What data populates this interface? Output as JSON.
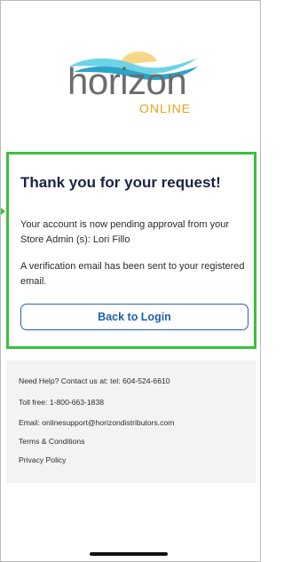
{
  "logo": {
    "wordmark": "horizon",
    "subtitle": "ONLINE",
    "colors": {
      "wave_light": "#6fd3e6",
      "wave_dark": "#2aa4c9",
      "sun": "#f4c24a",
      "wordmark": "#6c6c6c",
      "subtitle": "#e8a317"
    }
  },
  "confirmation": {
    "title": "Thank you for your request!",
    "pending_message": "Your account is now pending approval from your Store Admin (s): Lori Fillo",
    "verification_message": "A verification email has been sent to your registered email.",
    "back_button_label": "Back to Login",
    "highlight_color": "#3ac13a",
    "accent_color": "#1f5fa8"
  },
  "footer": {
    "help_line": "Need Help? Contact us at: tel: 604-524-6610",
    "toll_free": "Toll free: 1-800-663-1838",
    "email": "Email: onlinesupport@horizondistributors.com",
    "terms_link": "Terms & Conditions",
    "privacy_link": "Privacy Policy"
  }
}
